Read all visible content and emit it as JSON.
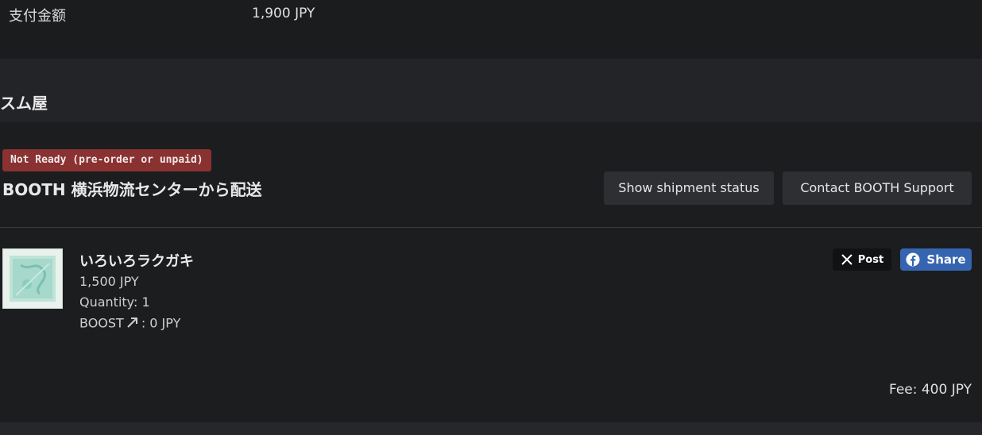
{
  "payment": {
    "label": "支付金额",
    "value": "1,900 JPY"
  },
  "shop": {
    "name": "スム屋"
  },
  "shipment": {
    "status_badge": "Not Ready (pre-order or unpaid)",
    "warehouse": "BOOTH 横浜物流センターから配送",
    "show_status_label": "Show shipment status",
    "contact_label": "Contact BOOTH Support"
  },
  "item": {
    "title": "いろいろラクガキ",
    "price": "1,500 JPY",
    "quantity": "Quantity: 1",
    "boost_label": "BOOST",
    "boost_value": ": 0 JPY",
    "boost_icon": "arrow-up-right-icon"
  },
  "share": {
    "x_label": "Post",
    "fb_label": "Share"
  },
  "fee": {
    "label": "Fee: 400 JPY"
  },
  "colors": {
    "background": "#1c1d1f",
    "badge": "#8a3131",
    "facebook": "#3565b0",
    "button": "#2e2f32"
  }
}
